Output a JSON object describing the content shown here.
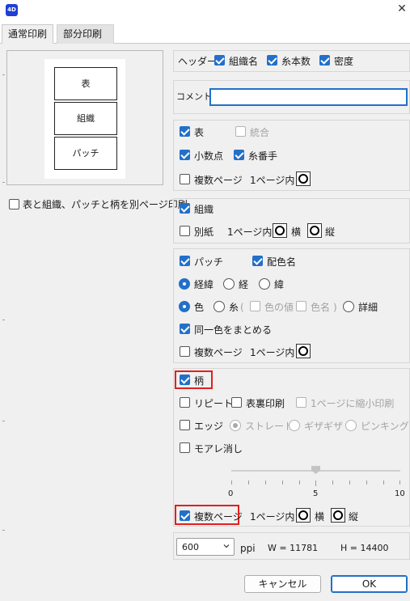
{
  "window": {
    "app_icon_text": "4D",
    "close_icon": "close-icon"
  },
  "tabs": [
    {
      "label": "通常印刷",
      "active": true
    },
    {
      "label": "部分印刷",
      "active": false
    }
  ],
  "preview": {
    "box1": "表",
    "box2": "組織",
    "box3": "パッチ"
  },
  "separate_page_label": "表と組織、パッチと柄を別ページ印刷",
  "header": {
    "label": "ヘッダー",
    "org_name": "組織名",
    "yarn_count": "糸本数",
    "density": "密度"
  },
  "comment": {
    "label": "コメント",
    "value": ""
  },
  "table_section": {
    "table": "表",
    "merge": "統合",
    "decimal": "小数点",
    "yarn_number": "糸番手",
    "multi_page": "複数ページ",
    "one_page": "1ページ内"
  },
  "weave_section": {
    "weave": "組織",
    "separate_sheet": "別紙",
    "one_page": "1ページ内",
    "horizontal": "横",
    "vertical": "縦"
  },
  "patch_section": {
    "patch": "パッチ",
    "color_name": "配色名",
    "warp_weft": "経緯",
    "warp": "経",
    "weft": "緯",
    "color": "色",
    "yarn": "糸",
    "open_paren": "(",
    "color_value": "色の値",
    "color_name2": "色名",
    "close_paren": ")",
    "detail": "詳細",
    "group_same_color": "同一色をまとめる",
    "multi_page": "複数ページ",
    "one_page": "1ページ内"
  },
  "pattern_section": {
    "pattern": "柄",
    "repeat": "リピート",
    "front_back": "表裏印刷",
    "shrink_to_page": "1ページに縮小印刷",
    "edge": "エッジ",
    "straight": "ストレート",
    "zigzag": "ギザギザ",
    "pinking": "ピンキング",
    "moire": "モアレ消し",
    "slider": {
      "min": "0",
      "mid": "5",
      "max": "10",
      "value": 5
    },
    "multi_page": "複数ページ",
    "one_page": "1ページ内",
    "horizontal": "横",
    "vertical": "縦"
  },
  "resolution": {
    "ppi_value": "600",
    "ppi_label": "ppi",
    "width": "W = 11781",
    "height": "H = 14400"
  },
  "buttons": {
    "cancel": "キャンセル",
    "ok": "OK"
  },
  "colors": {
    "accent": "#2270c9",
    "highlight": "#e02020"
  }
}
